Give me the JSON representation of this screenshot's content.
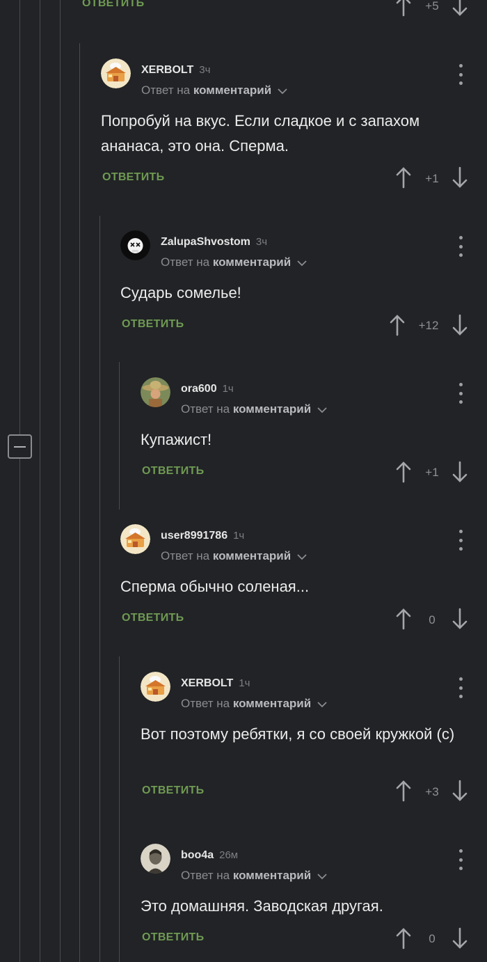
{
  "top_fragment": {
    "reply_label": "ОТВЕТИТЬ",
    "score": "+5"
  },
  "comments": [
    {
      "username": "XERBOLT",
      "time": "3ч",
      "reply_prefix": "Ответ на",
      "reply_target": "комментарий",
      "text": "Попробуй на вкус. Если сладкое и с запахом ананаса, это она. Сперма.",
      "reply_label": "ОТВЕТИТЬ",
      "score": "+1",
      "avatar_icon": "chef-house-avatar"
    },
    {
      "username": "ZalupaShvostom",
      "time": "3ч",
      "reply_prefix": "Ответ на",
      "reply_target": "комментарий",
      "text": "Сударь сомелье!",
      "reply_label": "ОТВЕТИТЬ",
      "score": "+12",
      "avatar_icon": "skull-avatar"
    },
    {
      "username": "ora600",
      "time": "1ч",
      "reply_prefix": "Ответ на",
      "reply_target": "комментарий",
      "text": "Купажист!",
      "reply_label": "ОТВЕТИТЬ",
      "score": "+1",
      "avatar_icon": "sombrero-avatar"
    },
    {
      "username": "user8991786",
      "time": "1ч",
      "reply_prefix": "Ответ на",
      "reply_target": "комментарий",
      "text": "Сперма обычно соленая...",
      "reply_label": "ОТВЕТИТЬ",
      "score": "0",
      "avatar_icon": "chef-house-avatar"
    },
    {
      "username": "XERBOLT",
      "time": "1ч",
      "reply_prefix": "Ответ на",
      "reply_target": "комментарий",
      "text": "Вот поэтому ребятки, я со своей кружкой (с)",
      "reply_label": "ОТВЕТИТЬ",
      "score": "+3",
      "avatar_icon": "chef-house-avatar"
    },
    {
      "username": "boo4a",
      "time": "26м",
      "reply_prefix": "Ответ на",
      "reply_target": "комментарий",
      "text": "Это домашняя. Заводская другая.",
      "reply_label": "ОТВЕТИТЬ",
      "score": "0",
      "avatar_icon": "portrait-avatar"
    }
  ],
  "colors": {
    "background": "#212326",
    "accent_reply": "#6f9a53",
    "thread_line": "#4a4c50"
  }
}
